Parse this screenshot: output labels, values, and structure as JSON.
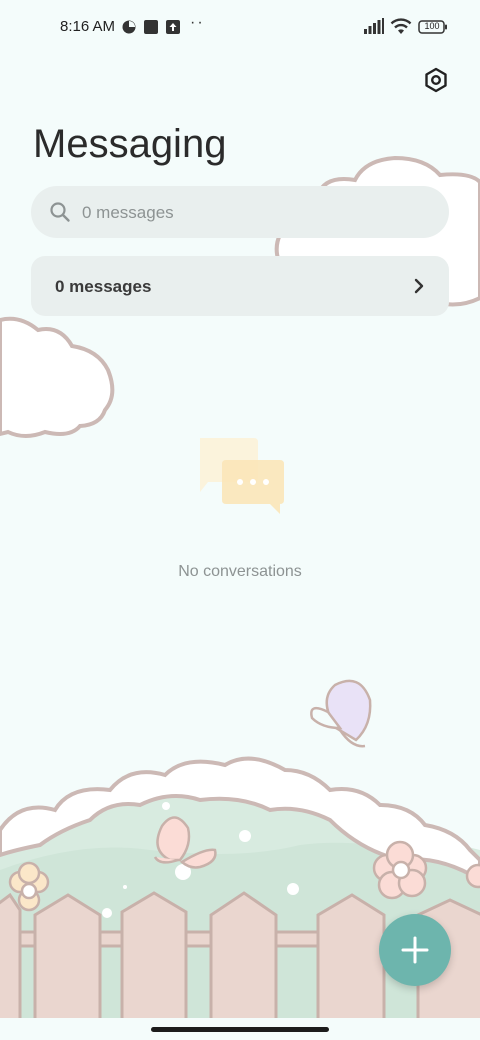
{
  "status_bar": {
    "time": "8:16 AM",
    "dots": "··",
    "battery": "100"
  },
  "header": {
    "title": "Messaging",
    "settings_icon": "gear-icon"
  },
  "search": {
    "placeholder": "0 messages"
  },
  "summary": {
    "label": "0 messages"
  },
  "empty_state": {
    "text": "No conversations"
  },
  "fab": {
    "icon": "plus-icon",
    "color": "#6db5ad"
  },
  "colors": {
    "background": "#f4fcfb",
    "card": "#e9efee",
    "accent": "#6db5ad"
  }
}
